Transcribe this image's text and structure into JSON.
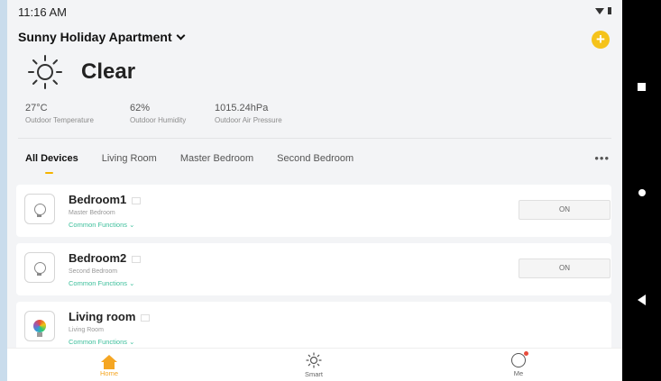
{
  "status_bar": {
    "time": "11:16 AM"
  },
  "home": {
    "name": "Sunny Holiday Apartment"
  },
  "weather": {
    "condition": "Clear",
    "stats": [
      {
        "value": "27°C",
        "label": "Outdoor Temperature"
      },
      {
        "value": "62%",
        "label": "Outdoor Humidity"
      },
      {
        "value": "1015.24hPa",
        "label": "Outdoor Air Pressure"
      }
    ]
  },
  "tabs": [
    "All Devices",
    "Living Room",
    "Master Bedroom",
    "Second Bedroom"
  ],
  "active_tab": "All Devices",
  "devices": [
    {
      "name": "Bedroom1",
      "room": "Master Bedroom",
      "functions": "Common Functions ⌄",
      "power_label": "ON",
      "icon": "bulb-icon"
    },
    {
      "name": "Bedroom2",
      "room": "Second Bedroom",
      "functions": "Common Functions ⌄",
      "power_label": "ON",
      "icon": "bulb-icon"
    },
    {
      "name": "Living room",
      "room": "Living Room",
      "functions": "Common Functions ⌄",
      "icon": "color-bulb-icon"
    }
  ],
  "bottom_nav": {
    "home": "Home",
    "smart": "Smart",
    "me": "Me"
  },
  "colors": {
    "accent": "#f5a623",
    "function_link": "#3cbf9b",
    "add_button": "#f5c31b"
  }
}
